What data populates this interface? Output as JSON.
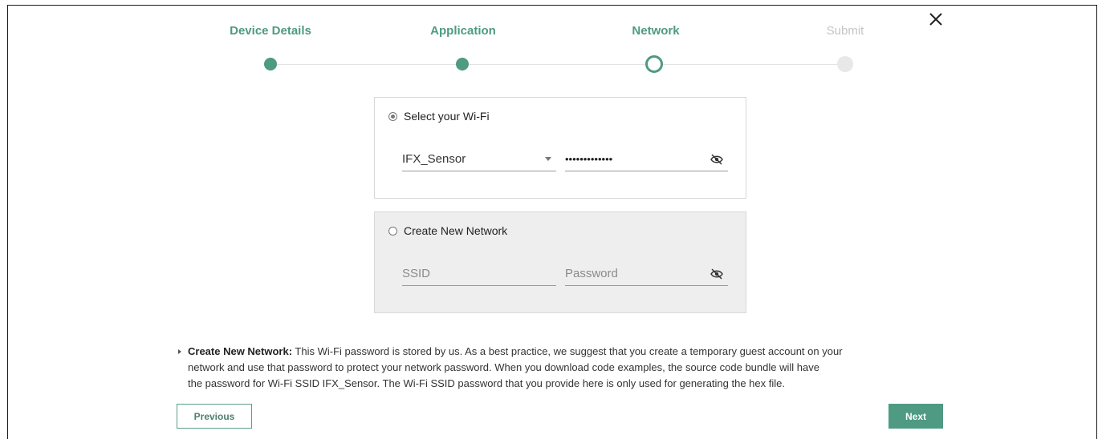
{
  "stepper": {
    "steps": [
      {
        "label": "Device Details",
        "state": "done"
      },
      {
        "label": "Application",
        "state": "done"
      },
      {
        "label": "Network",
        "state": "current"
      },
      {
        "label": "Submit",
        "state": "todo"
      }
    ]
  },
  "wifi": {
    "radio_label": "Select your Wi-Fi",
    "selected": true,
    "network_value": "IFX_Sensor",
    "password_masked": "•••••••••••••"
  },
  "create": {
    "radio_label": "Create New Network",
    "selected": false,
    "ssid_placeholder": "SSID",
    "password_placeholder": "Password"
  },
  "note": {
    "heading": "Create New Network:",
    "line1": " This Wi-Fi password is stored by us. As a best practice, we suggest that you create a temporary guest account on your",
    "line2": "network and use that password to protect your network password. When you download code examples, the source code bundle will have",
    "line3": "the password for Wi-Fi SSID IFX_Sensor. The Wi-Fi SSID password that you provide here is only used for generating the hex file."
  },
  "buttons": {
    "previous": "Previous",
    "next": "Next"
  },
  "colors": {
    "accent": "#4e9a82",
    "inactive": "#c4c4c4",
    "panel_disabled_bg": "#eeeeee"
  },
  "icons": {
    "close": "close-icon",
    "eye_off": "eye-off-icon",
    "dropdown": "chevron-down-icon"
  }
}
